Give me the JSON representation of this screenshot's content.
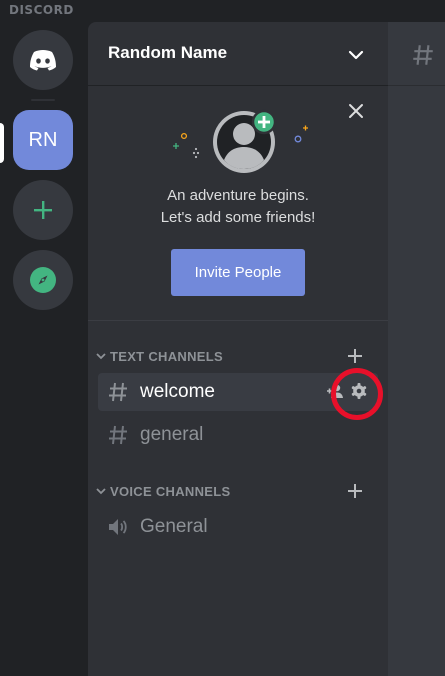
{
  "app": {
    "wordmark": "DISCORD"
  },
  "servers": {
    "home_icon": "discord-logo-icon",
    "current": {
      "initials": "RN"
    },
    "add_icon": "plus-icon",
    "explore_icon": "compass-icon",
    "accent_add": "#43b581",
    "accent_selected": "#7289da"
  },
  "sidebar": {
    "server_name": "Random Name",
    "invite_card": {
      "line1": "An adventure begins.",
      "line2": "Let's add some friends!",
      "button_label": "Invite People"
    },
    "text_category": {
      "label": "TEXT CHANNELS"
    },
    "text_channels": [
      {
        "name": "welcome",
        "selected": true
      },
      {
        "name": "general",
        "selected": false
      }
    ],
    "voice_category": {
      "label": "VOICE CHANNELS"
    },
    "voice_channels": [
      {
        "name": "General"
      }
    ]
  },
  "annotation": {
    "highlight_color": "#e8102a",
    "target": "gear-icon"
  }
}
